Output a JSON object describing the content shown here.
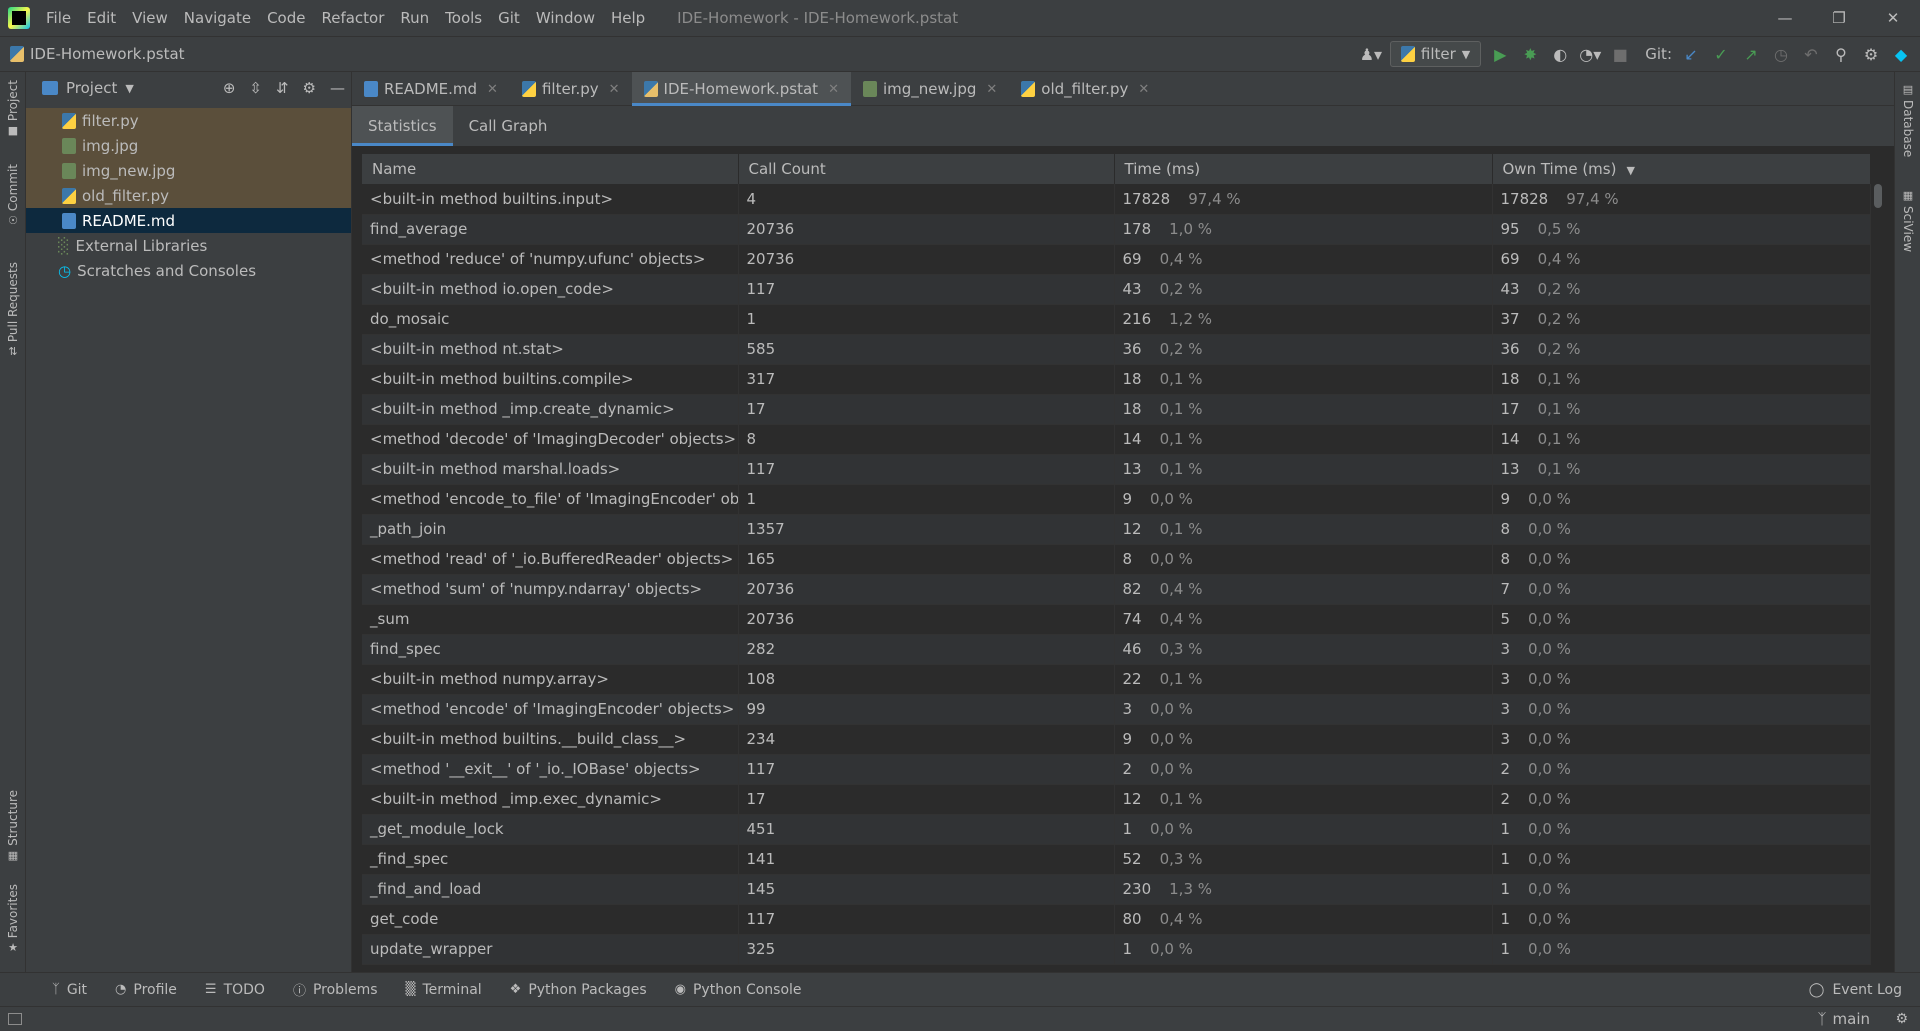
{
  "menubar": {
    "items": [
      "File",
      "Edit",
      "View",
      "Navigate",
      "Code",
      "Refactor",
      "Run",
      "Tools",
      "Git",
      "Window",
      "Help"
    ],
    "window_title": "IDE-Homework - IDE-Homework.pstat",
    "controls": {
      "minimize": "—",
      "restore": "❐",
      "close": "✕"
    }
  },
  "navbar": {
    "breadcrumb": "IDE-Homework.pstat",
    "run_config": "filter",
    "git_label": "Git:"
  },
  "left_strip": [
    "Project",
    "Commit",
    "Pull Requests",
    "Structure",
    "Favorites"
  ],
  "right_strip": [
    "Database",
    "SciView"
  ],
  "project": {
    "header": "Project",
    "files": [
      {
        "name": "filter.py",
        "type": "py"
      },
      {
        "name": "img.jpg",
        "type": "img"
      },
      {
        "name": "img_new.jpg",
        "type": "img"
      },
      {
        "name": "old_filter.py",
        "type": "py"
      },
      {
        "name": "README.md",
        "type": "md"
      }
    ],
    "external_libraries": "External Libraries",
    "scratches": "Scratches and Consoles"
  },
  "editor_tabs": [
    {
      "label": "README.md",
      "type": "md"
    },
    {
      "label": "filter.py",
      "type": "py"
    },
    {
      "label": "IDE-Homework.pstat",
      "type": "pstat",
      "active": true
    },
    {
      "label": "img_new.jpg",
      "type": "img"
    },
    {
      "label": "old_filter.py",
      "type": "py"
    }
  ],
  "sub_tabs": [
    "Statistics",
    "Call Graph"
  ],
  "table": {
    "headers": {
      "name": "Name",
      "calls": "Call Count",
      "time": "Time (ms)",
      "own": "Own Time (ms)"
    },
    "rows": [
      [
        "<built-in method builtins.input>",
        "4",
        "17828",
        "97,4 %",
        "17828",
        "97,4 %"
      ],
      [
        "find_average",
        "20736",
        "178",
        "1,0 %",
        "95",
        "0,5 %"
      ],
      [
        "<method 'reduce' of 'numpy.ufunc' objects>",
        "20736",
        "69",
        "0,4 %",
        "69",
        "0,4 %"
      ],
      [
        "<built-in method io.open_code>",
        "117",
        "43",
        "0,2 %",
        "43",
        "0,2 %"
      ],
      [
        "do_mosaic",
        "1",
        "216",
        "1,2 %",
        "37",
        "0,2 %"
      ],
      [
        "<built-in method nt.stat>",
        "585",
        "36",
        "0,2 %",
        "36",
        "0,2 %"
      ],
      [
        "<built-in method builtins.compile>",
        "317",
        "18",
        "0,1 %",
        "18",
        "0,1 %"
      ],
      [
        "<built-in method _imp.create_dynamic>",
        "17",
        "18",
        "0,1 %",
        "17",
        "0,1 %"
      ],
      [
        "<method 'decode' of 'ImagingDecoder' objects>",
        "8",
        "14",
        "0,1 %",
        "14",
        "0,1 %"
      ],
      [
        "<built-in method marshal.loads>",
        "117",
        "13",
        "0,1 %",
        "13",
        "0,1 %"
      ],
      [
        "<method 'encode_to_file' of 'ImagingEncoder' objects>",
        "1",
        "9",
        "0,0 %",
        "9",
        "0,0 %"
      ],
      [
        "_path_join",
        "1357",
        "12",
        "0,1 %",
        "8",
        "0,0 %"
      ],
      [
        "<method 'read' of '_io.BufferedReader' objects>",
        "165",
        "8",
        "0,0 %",
        "8",
        "0,0 %"
      ],
      [
        "<method 'sum' of 'numpy.ndarray' objects>",
        "20736",
        "82",
        "0,4 %",
        "7",
        "0,0 %"
      ],
      [
        "_sum",
        "20736",
        "74",
        "0,4 %",
        "5",
        "0,0 %"
      ],
      [
        "find_spec",
        "282",
        "46",
        "0,3 %",
        "3",
        "0,0 %"
      ],
      [
        "<built-in method numpy.array>",
        "108",
        "22",
        "0,1 %",
        "3",
        "0,0 %"
      ],
      [
        "<method 'encode' of 'ImagingEncoder' objects>",
        "99",
        "3",
        "0,0 %",
        "3",
        "0,0 %"
      ],
      [
        "<built-in method builtins.__build_class__>",
        "234",
        "9",
        "0,0 %",
        "3",
        "0,0 %"
      ],
      [
        "<method '__exit__' of '_io._IOBase' objects>",
        "117",
        "2",
        "0,0 %",
        "2",
        "0,0 %"
      ],
      [
        "<built-in method _imp.exec_dynamic>",
        "17",
        "12",
        "0,1 %",
        "2",
        "0,0 %"
      ],
      [
        "_get_module_lock",
        "451",
        "1",
        "0,0 %",
        "1",
        "0,0 %"
      ],
      [
        "_find_spec",
        "141",
        "52",
        "0,3 %",
        "1",
        "0,0 %"
      ],
      [
        "_find_and_load",
        "145",
        "230",
        "1,3 %",
        "1",
        "0,0 %"
      ],
      [
        "get_code",
        "117",
        "80",
        "0,4 %",
        "1",
        "0,0 %"
      ],
      [
        "update_wrapper",
        "325",
        "1",
        "0,0 %",
        "1",
        "0,0 %"
      ]
    ]
  },
  "bottom_tools": [
    {
      "label": "Git",
      "icon": "branch-icon"
    },
    {
      "label": "Profile",
      "icon": "profile-icon"
    },
    {
      "label": "TODO",
      "icon": "list-icon"
    },
    {
      "label": "Problems",
      "icon": "problems-icon"
    },
    {
      "label": "Terminal",
      "icon": "terminal-icon"
    },
    {
      "label": "Python Packages",
      "icon": "packages-icon"
    },
    {
      "label": "Python Console",
      "icon": "python-console-icon"
    }
  ],
  "event_log": "Event Log",
  "status": {
    "branch": "main"
  },
  "colors": {
    "accent": "#4a88c7",
    "run_green": "#499c54",
    "selection": "#0d293e",
    "highlight": "#5b4f3b"
  }
}
